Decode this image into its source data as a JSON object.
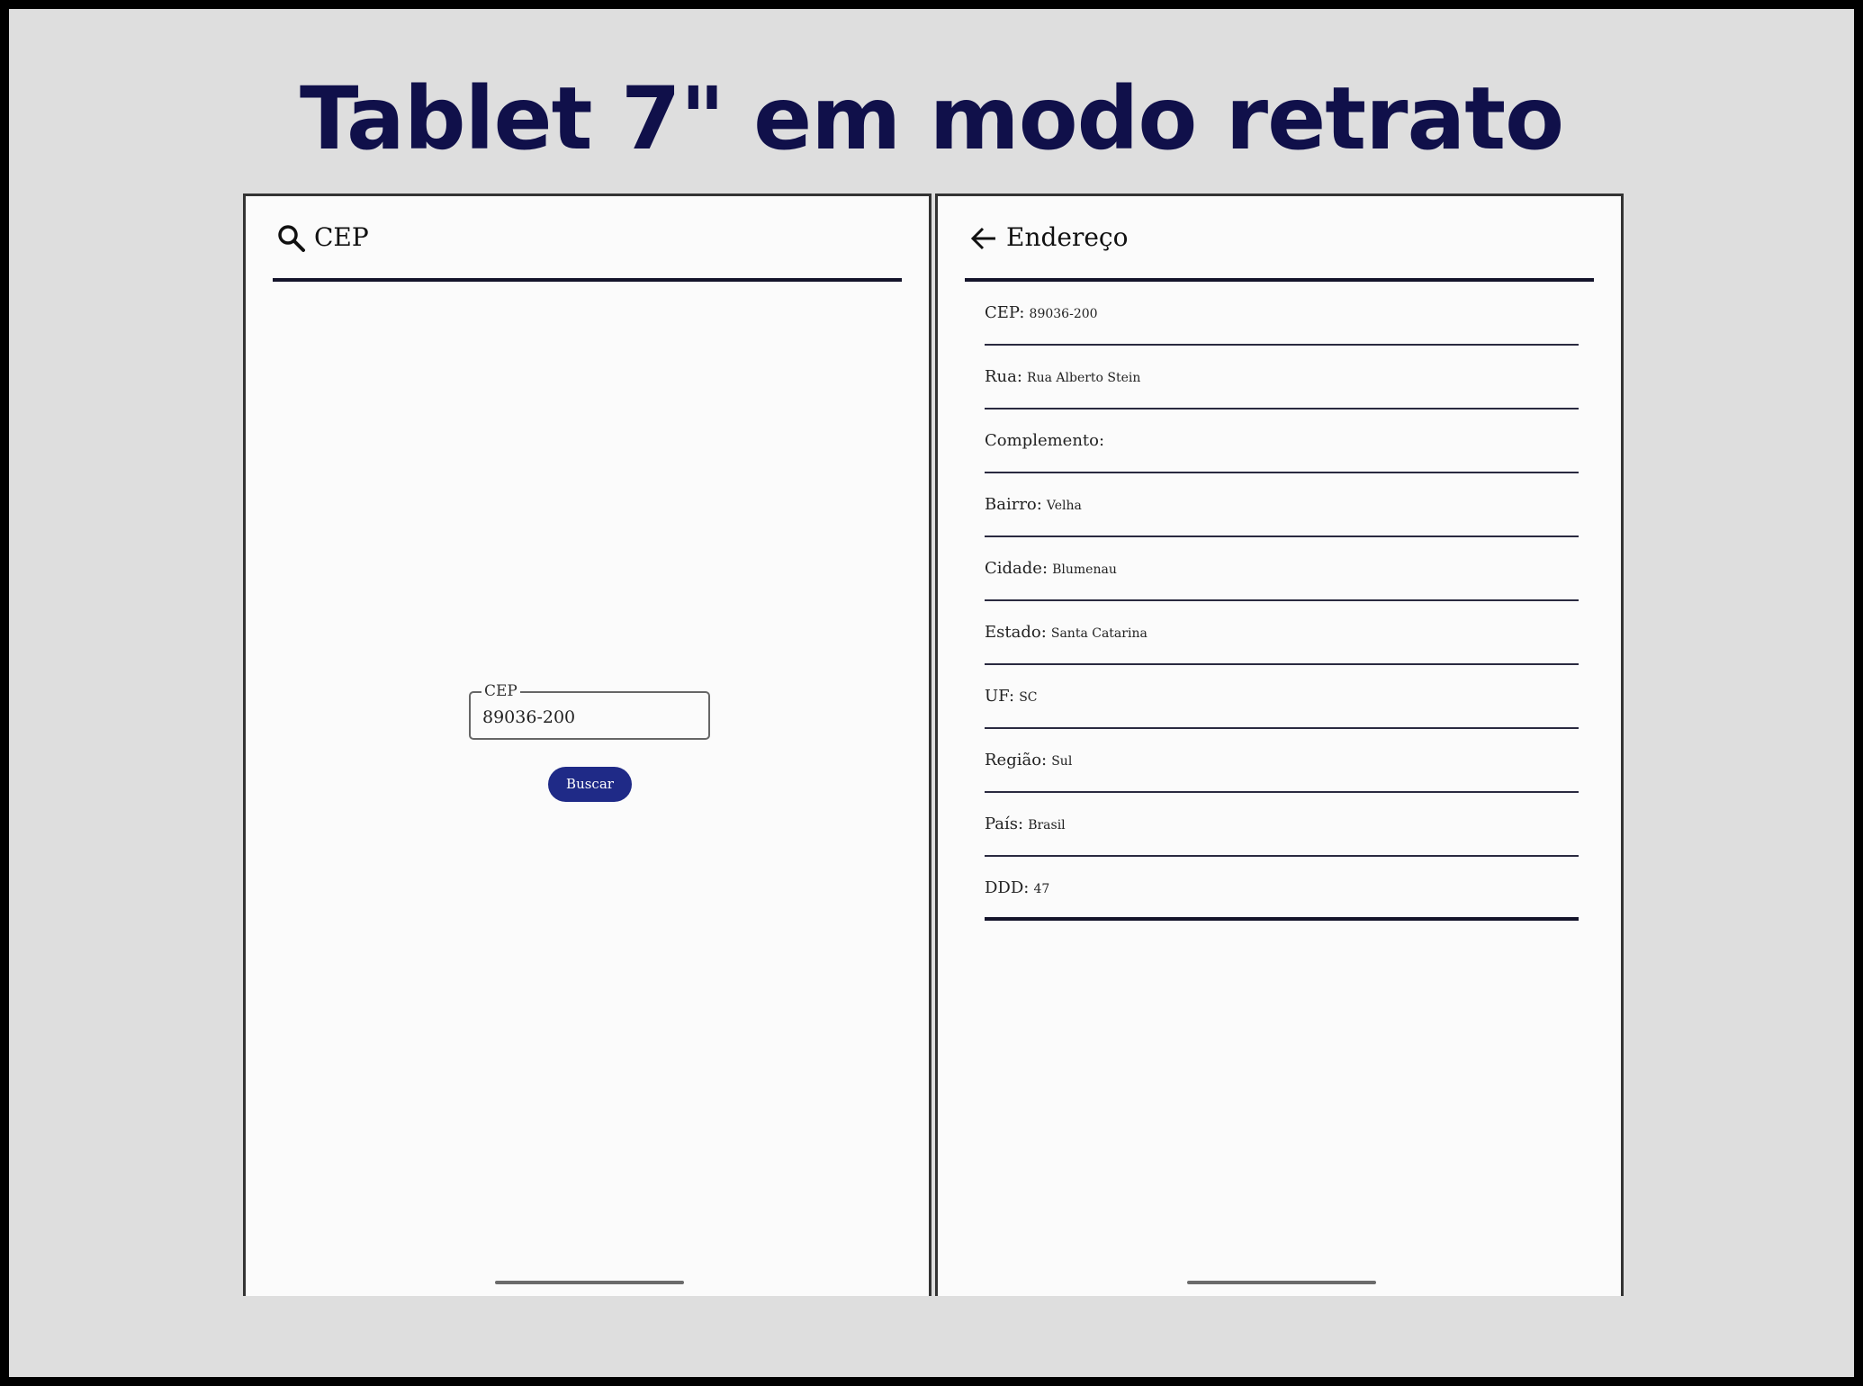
{
  "slide": {
    "title": "Tablet 7\" em modo retrato"
  },
  "search_screen": {
    "appbar_title": "CEP",
    "appbar_icon": "search-icon",
    "cep_field": {
      "label": "CEP",
      "value": "89036-200"
    },
    "search_button_label": "Buscar"
  },
  "address_screen": {
    "appbar_title": "Endereço",
    "appbar_icon": "arrow-left-icon",
    "rows": [
      {
        "label": "CEP:",
        "value": "89036-200"
      },
      {
        "label": "Rua:",
        "value": "Rua Alberto Stein"
      },
      {
        "label": "Complemento:",
        "value": ""
      },
      {
        "label": "Bairro:",
        "value": "Velha"
      },
      {
        "label": "Cidade:",
        "value": "Blumenau"
      },
      {
        "label": "Estado:",
        "value": "Santa Catarina"
      },
      {
        "label": "UF:",
        "value": "SC"
      },
      {
        "label": "Região:",
        "value": "Sul"
      },
      {
        "label": "País:",
        "value": "Brasil"
      },
      {
        "label": "DDD:",
        "value": "47"
      }
    ]
  },
  "colors": {
    "title": "#10104a",
    "background": "#dedede",
    "screen": "#fbfbfb",
    "button": "#1f2a87"
  }
}
